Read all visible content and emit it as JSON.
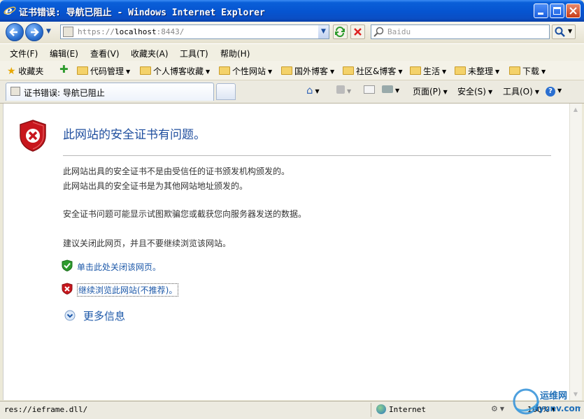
{
  "window": {
    "title": "证书错误: 导航已阻止 - Windows Internet Explorer"
  },
  "address_bar": {
    "url_scheme": "https://",
    "url_host": "localhost",
    "url_rest": ":8443/",
    "search_placeholder": "Baidu"
  },
  "menu": [
    "文件(F)",
    "编辑(E)",
    "查看(V)",
    "收藏夹(A)",
    "工具(T)",
    "帮助(H)"
  ],
  "favorites": {
    "label": "收藏夹",
    "folders": [
      "代码管理",
      "个人博客收藏",
      "个性网站",
      "国外博客",
      "社区&博客",
      "生活",
      "未整理",
      "下载"
    ]
  },
  "tab": {
    "title": "证书错误: 导航已阻止"
  },
  "command_bar": {
    "page": "页面(P)",
    "safety": "安全(S)",
    "tools": "工具(O)"
  },
  "page": {
    "heading": "此网站的安全证书有问题。",
    "line1": "此网站出具的安全证书不是由受信任的证书颁发机构颁发的。",
    "line2": "此网站出具的安全证书是为其他网站地址颁发的。",
    "line3": "安全证书问题可能显示试图欺骗您或截获您向服务器发送的数据。",
    "line4": "建议关闭此网页，并且不要继续浏览该网站。",
    "close_link": "单击此处关闭该网页。",
    "continue_link": "继续浏览此网站(不推荐)。",
    "more_info": "更多信息"
  },
  "status_bar": {
    "text": "res://ieframe.dll/",
    "zone": "Internet",
    "zoom": "100%"
  },
  "watermark": "运维网 iyunv.com",
  "colors": {
    "titlebar": "#0654d0",
    "heading": "#1f4e9e",
    "link": "#1b57a8",
    "shield_red": "#c8161d",
    "shield_green": "#2e9b2e"
  }
}
